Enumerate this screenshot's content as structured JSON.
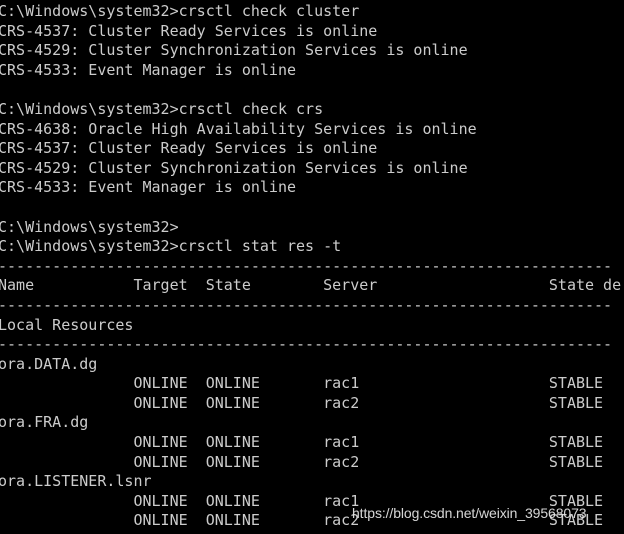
{
  "window": {
    "kind": "windows-command-prompt",
    "background_color": "#000000",
    "foreground_color": "#cccccc",
    "prompt": "C:\\Windows\\system32>"
  },
  "watermark": {
    "text": "https://blog.csdn.net/weixin_39568073",
    "color": "#e8e8e8"
  },
  "terminal": {
    "lines": [
      "C:\\Windows\\system32>crsctl check cluster",
      "CRS-4537: Cluster Ready Services is online",
      "CRS-4529: Cluster Synchronization Services is online",
      "CRS-4533: Event Manager is online",
      "",
      "C:\\Windows\\system32>crsctl check crs",
      "CRS-4638: Oracle High Availability Services is online",
      "CRS-4537: Cluster Ready Services is online",
      "CRS-4529: Cluster Synchronization Services is online",
      "CRS-4533: Event Manager is online",
      "",
      "C:\\Windows\\system32>",
      "C:\\Windows\\system32>crsctl stat res -t",
      "--------------------------------------------------------------------",
      "Name           Target  State        Server                   State de",
      "--------------------------------------------------------------------",
      "Local Resources",
      "--------------------------------------------------------------------",
      "ora.DATA.dg",
      "               ONLINE  ONLINE       rac1                     STABLE",
      "               ONLINE  ONLINE       rac2                     STABLE",
      "ora.FRA.dg",
      "               ONLINE  ONLINE       rac1                     STABLE",
      "               ONLINE  ONLINE       rac2                     STABLE",
      "ora.LISTENER.lsnr",
      "               ONLINE  ONLINE       rac1                     STABLE",
      "               ONLINE  ONLINE       rac2                     STABLE"
    ],
    "commands": [
      "crsctl check cluster",
      "crsctl check crs",
      "crsctl stat res -t"
    ],
    "status_messages": [
      {
        "code": "CRS-4537",
        "text": "Cluster Ready Services is online"
      },
      {
        "code": "CRS-4529",
        "text": "Cluster Synchronization Services is online"
      },
      {
        "code": "CRS-4533",
        "text": "Event Manager is online"
      },
      {
        "code": "CRS-4638",
        "text": "Oracle High Availability Services is online"
      }
    ],
    "resource_table": {
      "headers": [
        "Name",
        "Target",
        "State",
        "Server",
        "State de"
      ],
      "section": "Local Resources",
      "rows": [
        {
          "name": "ora.DATA.dg",
          "entries": [
            {
              "target": "ONLINE",
              "state": "ONLINE",
              "server": "rac1",
              "details": "STABLE"
            },
            {
              "target": "ONLINE",
              "state": "ONLINE",
              "server": "rac2",
              "details": "STABLE"
            }
          ]
        },
        {
          "name": "ora.FRA.dg",
          "entries": [
            {
              "target": "ONLINE",
              "state": "ONLINE",
              "server": "rac1",
              "details": "STABLE"
            },
            {
              "target": "ONLINE",
              "state": "ONLINE",
              "server": "rac2",
              "details": "STABLE"
            }
          ]
        },
        {
          "name": "ora.LISTENER.lsnr",
          "entries": [
            {
              "target": "ONLINE",
              "state": "ONLINE",
              "server": "rac1",
              "details": "STABLE"
            },
            {
              "target": "ONLINE",
              "state": "ONLINE",
              "server": "rac2",
              "details": "STABLE"
            }
          ]
        }
      ]
    }
  }
}
